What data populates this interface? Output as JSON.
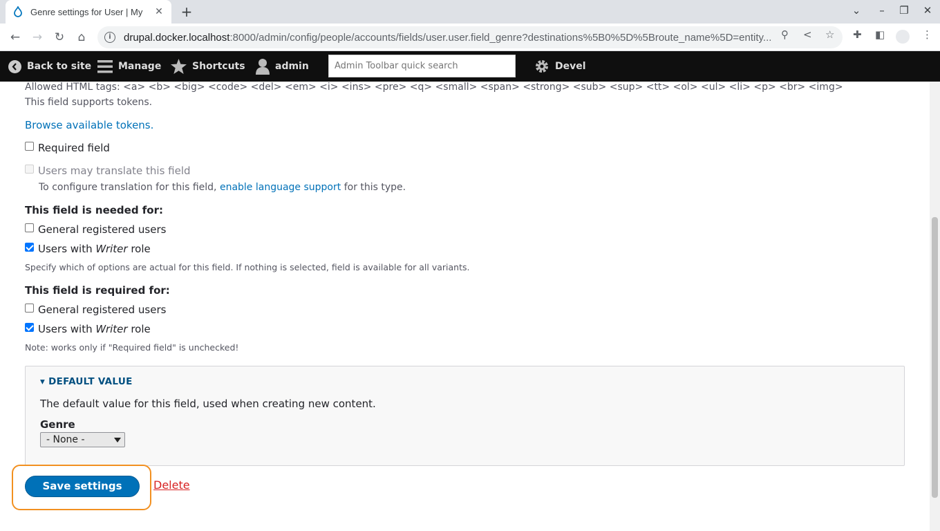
{
  "browser": {
    "tab_title": "Genre settings for User | My",
    "tab_close": "✕",
    "new_tab": "+",
    "url_host": "drupal.docker.localhost",
    "url_rest": ":8000/admin/config/people/accounts/fields/user.user.field_genre?destinations%5B0%5D%5Broute_name%5D=entity..."
  },
  "toolbar": {
    "back_to_site": "Back to site",
    "manage": "Manage",
    "shortcuts": "Shortcuts",
    "user": "admin",
    "search_placeholder": "Admin Toolbar quick search",
    "devel": "Devel"
  },
  "form": {
    "allowed_html": "Allowed HTML tags: <a> <b> <big> <code> <del> <em> <i> <ins> <pre> <q> <small> <span> <strong> <sub> <sup> <tt> <ol> <ul> <li> <p> <br> <img>",
    "supports_tokens": "This field supports tokens.",
    "browse_tokens": "Browse available tokens.",
    "required_field": "Required field",
    "translate_field": "Users may translate this field",
    "translate_note_prefix": "To configure translation for this field, ",
    "translate_note_link": "enable language support",
    "translate_note_suffix": " for this type.",
    "needed_for": {
      "heading": "This field is needed for:",
      "general": "General registered users",
      "writer_prefix": "Users with ",
      "writer_role": "Writer",
      "writer_suffix": " role",
      "description": "Specify which of options are actual for this field. If nothing is selected, field is available for all variants."
    },
    "required_for": {
      "heading": "This field is required for:",
      "general": "General registered users",
      "writer_prefix": "Users with ",
      "writer_role": "Writer",
      "writer_suffix": " role",
      "description": "Note: works only if \"Required field\" is unchecked!"
    },
    "default_value": {
      "summary": "DEFAULT VALUE",
      "description": "The default value for this field, used when creating new content.",
      "genre_label": "Genre",
      "genre_selected": "- None -"
    },
    "save_label": "Save settings",
    "delete_label": "Delete"
  }
}
